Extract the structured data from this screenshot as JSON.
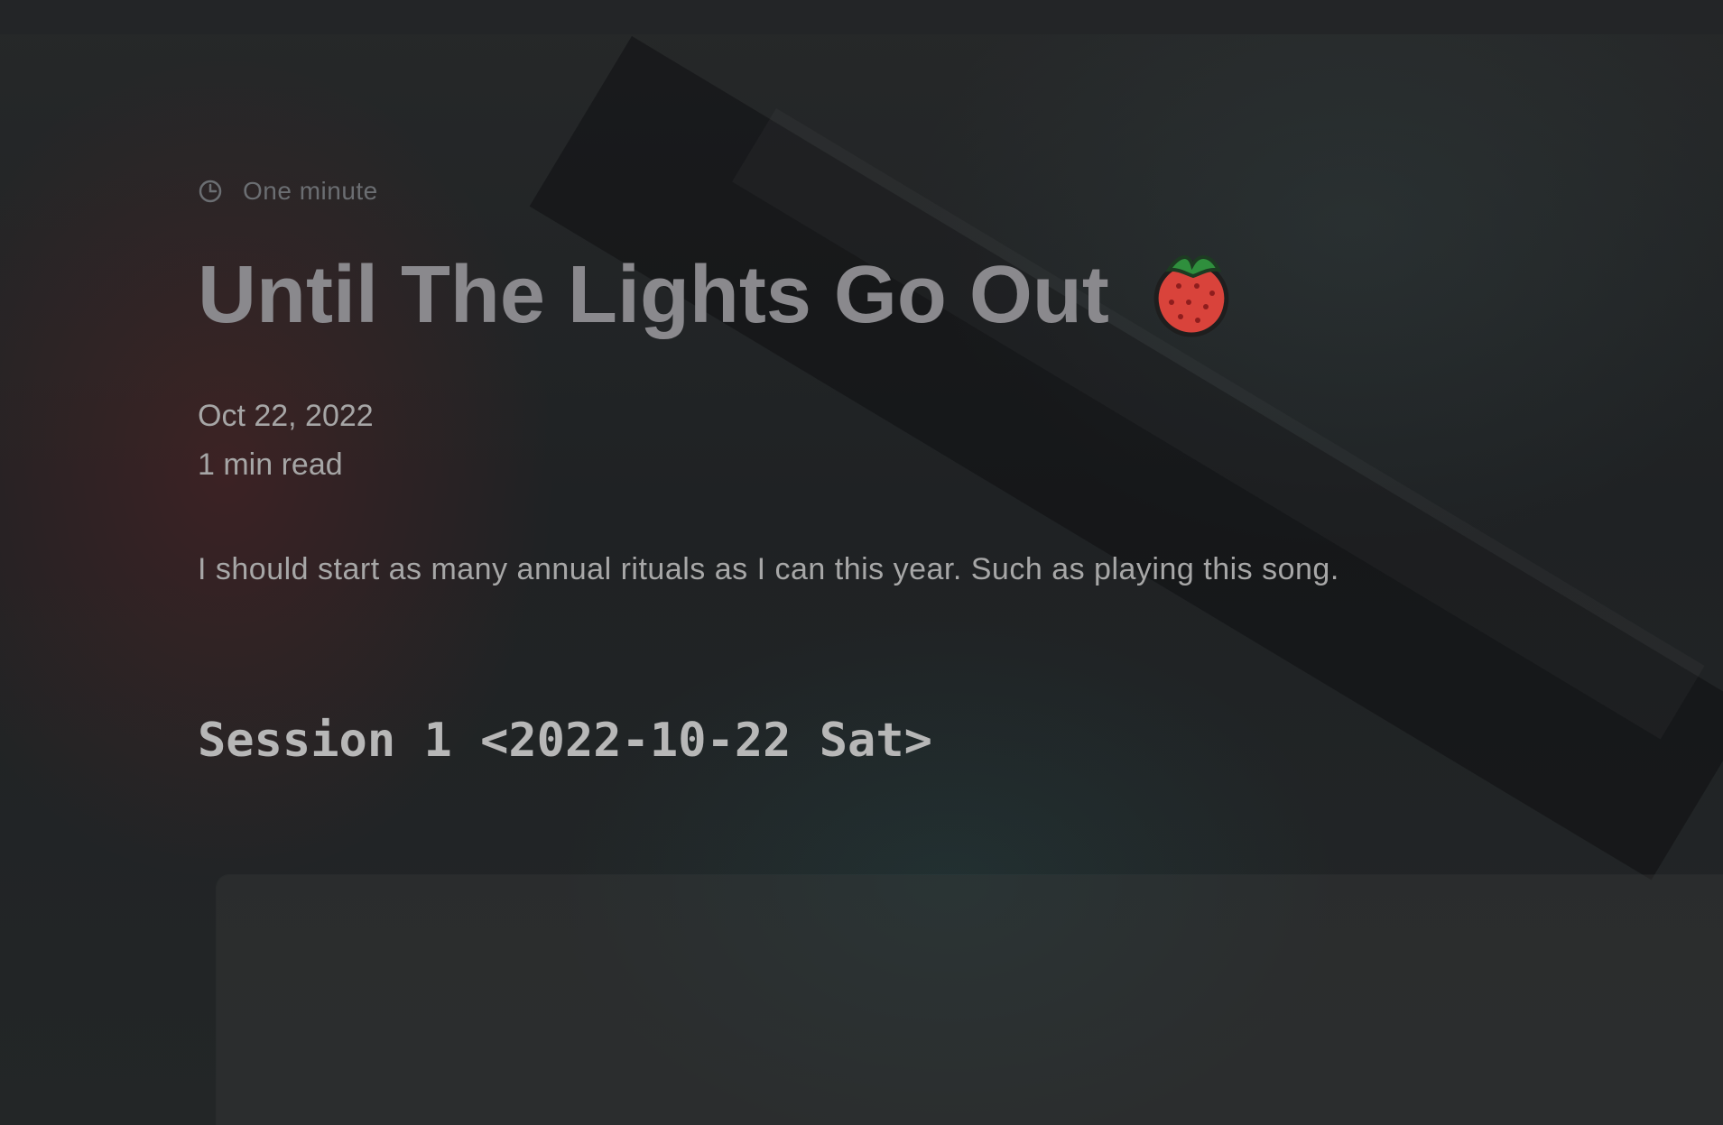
{
  "header": {
    "reading_time": "One minute",
    "clock_icon": "clock-icon"
  },
  "post": {
    "title": "Until The Lights Go Out",
    "emoji_icon": "strawberry-icon",
    "date": "Oct 22, 2022",
    "read_time": "1 min read",
    "excerpt": "I should start as many annual rituals as I can this year. Such as playing this song.",
    "session_heading": "Session 1 <2022-10-22 Sat>"
  },
  "colors": {
    "background": "#1d1f21",
    "title": "#8a898d",
    "muted_text": "#6b6e72",
    "body_text": "#a7a7a7",
    "strawberry": "#d9433b",
    "leaf": "#2f8f3d"
  }
}
